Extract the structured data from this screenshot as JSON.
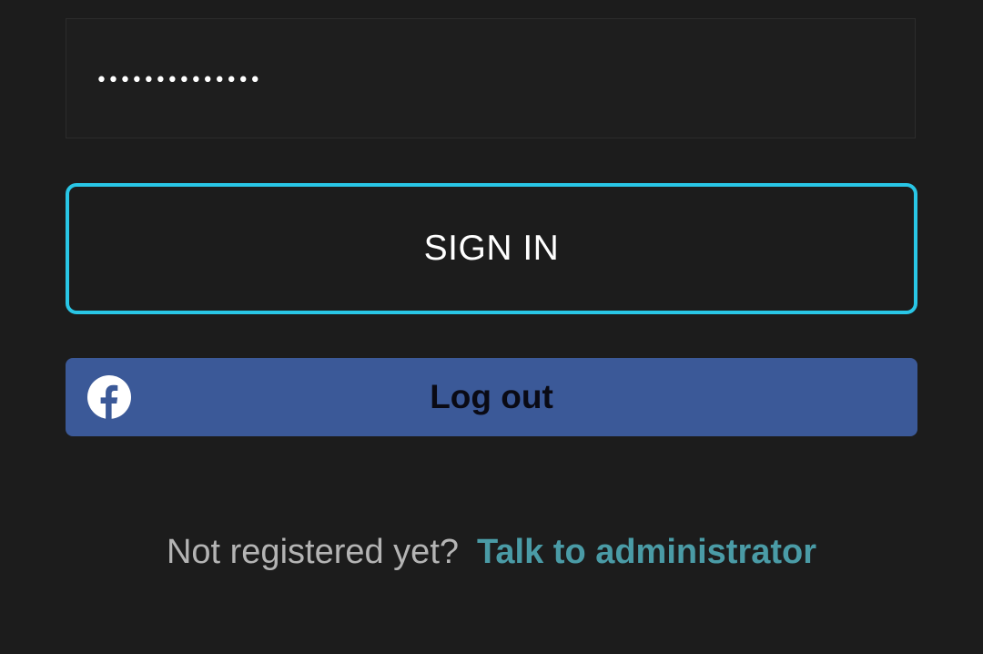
{
  "password_field": {
    "masked_value": "••••••••••••••"
  },
  "sign_in_button": {
    "label": "SIGN IN"
  },
  "facebook_button": {
    "label": "Log out",
    "icon": "facebook-icon"
  },
  "register": {
    "prompt": "Not registered yet?",
    "link": "Talk to administrator"
  },
  "colors": {
    "background": "#1c1c1c",
    "accent_border": "#29c6e6",
    "facebook_blue": "#3b5998",
    "link": "#4a9ba6"
  }
}
